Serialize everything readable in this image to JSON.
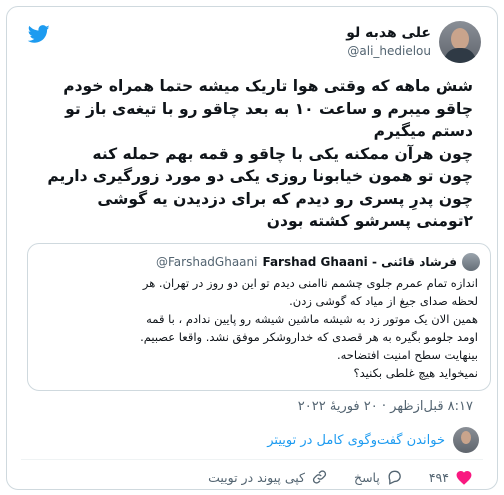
{
  "author": {
    "name": "علی هدبه لو",
    "handle": "@ali_hedielou"
  },
  "tweet": {
    "text": "شش ماهه که وقتی هوا تاریک میشه حتما همراه خودم\nچاقو میبرم و ساعت ۱۰ به بعد چاقو رو با تیغه‌ی باز تو\nدستم میگیرم\nچون هرآن ممکنه یکی با چاقو و قمه بهم حمله کنه\nچون تو همون خیابونا روزی یکی دو مورد زورگیری داریم\nچون پدرِ پسری رو دیدم که برای دزدیدن یه گوشی\n۲تومنی پسرشو کشته بودن"
  },
  "quoted": {
    "name": "فرشاد قائنی - Farshad Ghaani",
    "handle": "@FarshadGhaani",
    "text": "اندازه تمام عمرم جلوی چشمم ناامنی دیدم تو این دو روز در تهران. هر\nلحظه صدای جیغ از میاد که گوشی زدن.\nهمین الان یک موتور زد به شیشه ماشین شیشه رو پایین ندادم ، با قمه\nاومد جلومو بگیره به هر قصدی که خداروشکر موفق نشد. واقعا عصبیم.\nبینهایت سطح امنیت افتضاحه.\nنمیخواید هیچ غلطی بکنید؟"
  },
  "timestamp": "۸:۱۷ قبل‌ازظهر · ۲۰ فوریهٔ ۲۰۲۲",
  "conversation_link": "خواندن گفت‌وگوی کامل در توییتر",
  "actions": {
    "like_count": "۴۹۴",
    "reply_label": "پاسخ",
    "copy_link_label": "کپی پیوند در توییت"
  },
  "colors": {
    "twitter_blue": "#1d9bf0",
    "like_red": "#f91880"
  }
}
